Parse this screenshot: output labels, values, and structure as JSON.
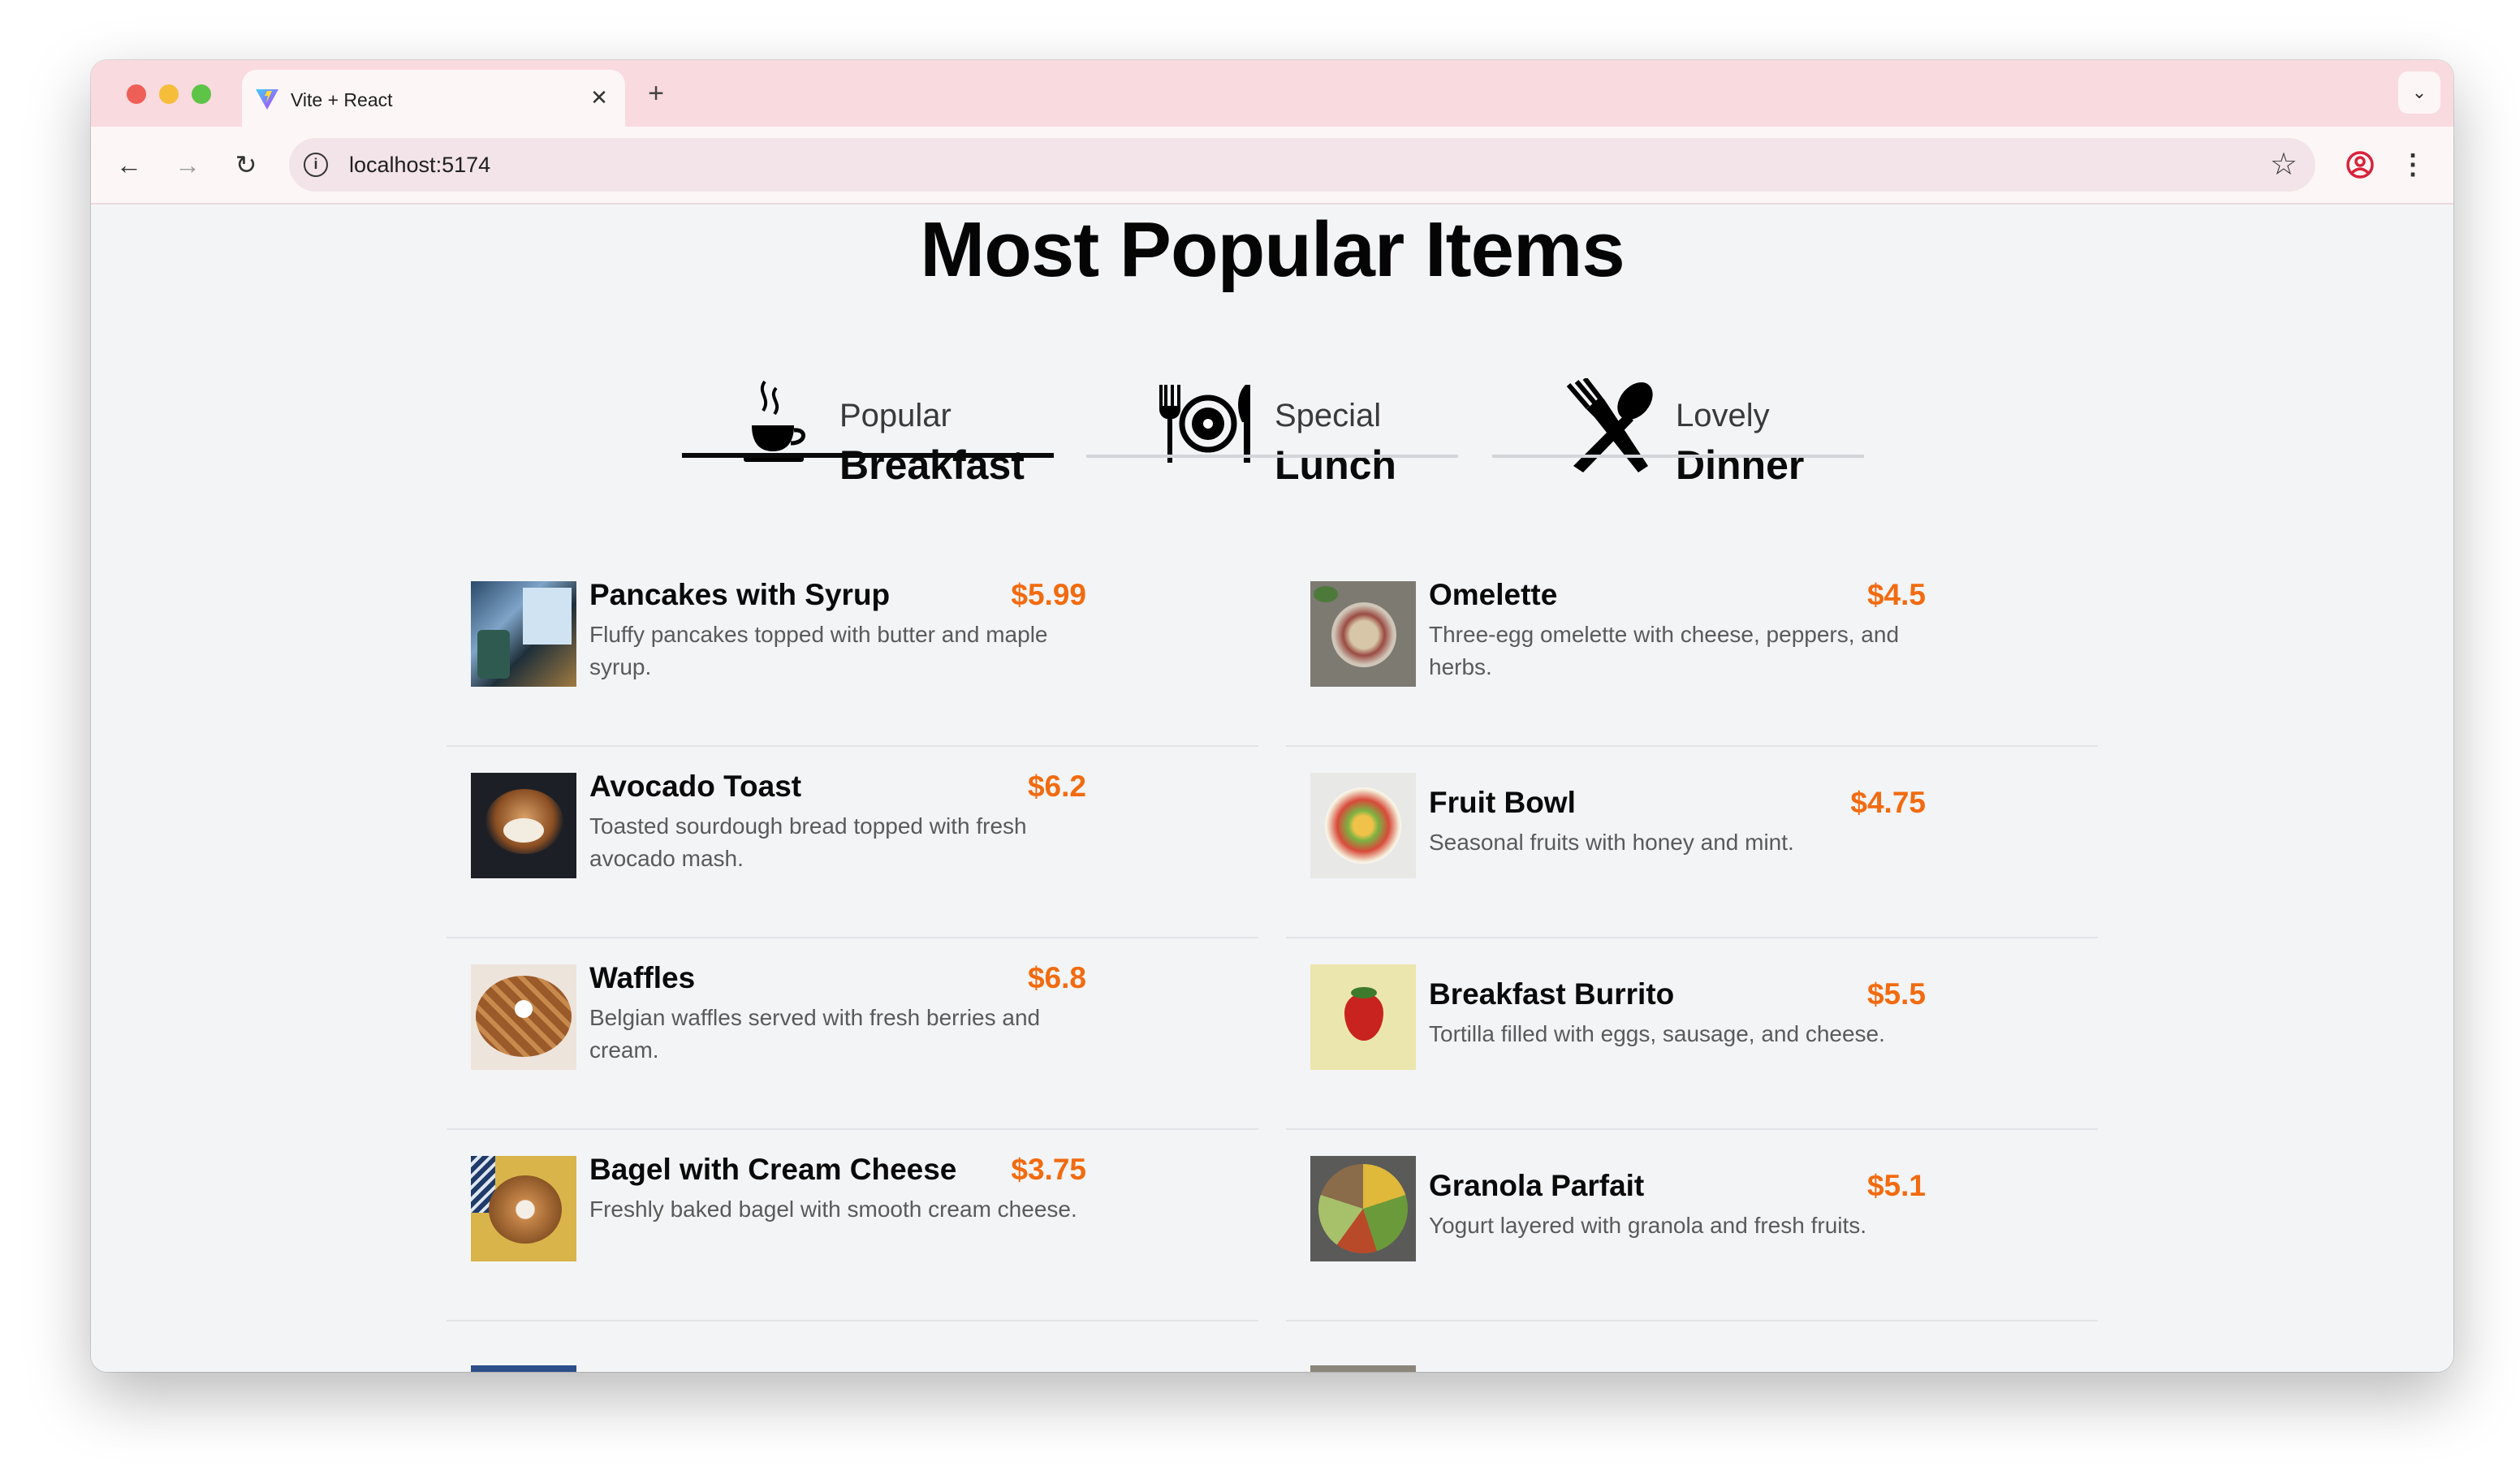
{
  "browser": {
    "tab_title": "Vite + React",
    "tab_close": "✕",
    "new_tab": "+",
    "tab_search": "⌄",
    "url": "localhost:5174",
    "back": "←",
    "forward": "→",
    "reload": "↻",
    "info": "i",
    "star": "☆",
    "menu": "⋮"
  },
  "page": {
    "heading": "Most Popular Items",
    "tabs": [
      {
        "sub": "Popular",
        "main": "Breakfast",
        "icon": "coffee-cup-icon",
        "active": true
      },
      {
        "sub": "Special",
        "main": "Lunch",
        "icon": "plate-fork-knife-icon",
        "active": false
      },
      {
        "sub": "Lovely",
        "main": "Dinner",
        "icon": "crossed-fork-spoon-icon",
        "active": false
      }
    ],
    "items": [
      {
        "name": "Pancakes with Syrup",
        "price": "$5.99",
        "desc": "Fluffy pancakes topped with butter and maple syrup."
      },
      {
        "name": "Omelette",
        "price": "$4.5",
        "desc": "Three-egg omelette with cheese, peppers, and herbs."
      },
      {
        "name": "Avocado Toast",
        "price": "$6.2",
        "desc": "Toasted sourdough bread topped with fresh avocado mash."
      },
      {
        "name": "Fruit Bowl",
        "price": "$4.75",
        "desc": "Seasonal fruits with honey and mint."
      },
      {
        "name": "Waffles",
        "price": "$6.8",
        "desc": "Belgian waffles served with fresh berries and cream."
      },
      {
        "name": "Breakfast Burrito",
        "price": "$5.5",
        "desc": "Tortilla filled with eggs, sausage, and cheese."
      },
      {
        "name": "Bagel with Cream Cheese",
        "price": "$3.75",
        "desc": "Freshly baked bagel with smooth cream cheese."
      },
      {
        "name": "Granola Parfait",
        "price": "$5.1",
        "desc": "Yogurt layered with granola and fresh fruits."
      }
    ]
  },
  "colors": {
    "tabstrip": "#f9dadf",
    "toolbar": "#fdf6f6",
    "page_bg": "#f3f4f6",
    "price": "#f26b10",
    "active_tab_bar": "#0a0a0a"
  }
}
